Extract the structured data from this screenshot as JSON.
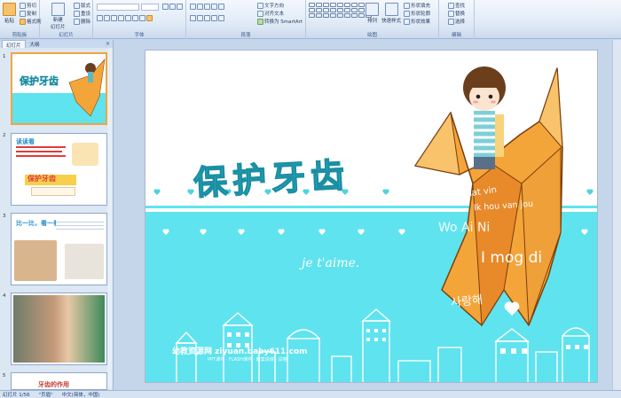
{
  "ribbon": {
    "clipboard": {
      "paste": "粘贴",
      "cut": "剪切",
      "copy": "复制",
      "format_painter": "格式刷",
      "label": "剪贴板"
    },
    "slides": {
      "new_slide": "新建",
      "new_slide2": "幻灯片",
      "layout": "版式",
      "reset": "重设",
      "delete": "删除",
      "label": "幻灯片"
    },
    "font": {
      "label": "字体"
    },
    "paragraph": {
      "text_direction": "文字方向",
      "align_text": "对齐文本",
      "smartart": "转换为 SmartArt",
      "label": "段落"
    },
    "drawing": {
      "arrange": "排列",
      "quick_styles": "快速样式",
      "shape_fill": "形状填充",
      "shape_outline": "形状轮廓",
      "shape_effects": "形状效果",
      "label": "绘图"
    },
    "editing": {
      "find": "查找",
      "replace": "替换",
      "select": "选择",
      "label": "编辑"
    }
  },
  "pane": {
    "tab_slides": "幻灯片",
    "tab_outline": "大纲",
    "close": "×",
    "thumbs": [
      {
        "num": "1",
        "title": "保护牙齿"
      },
      {
        "num": "2",
        "title": "读读看",
        "sub": "保护牙齿"
      },
      {
        "num": "3",
        "title": "比一比，看一看"
      },
      {
        "num": "4",
        "title": ""
      },
      {
        "num": "5",
        "title": "牙齿的作用"
      }
    ]
  },
  "slide": {
    "title": "保护牙齿",
    "phrases": [
      "amat vin",
      "Ik hou van jou",
      "je t'aime",
      "Wo Ai Ni",
      "I mog di",
      "사랑해"
    ],
    "script_text": "je t'aime.",
    "watermark": "幼教资源网 ziyuan.baby611.com",
    "watermark_sub": "PPT课件 · FLASH课件 · 教案说课 · 试卷"
  },
  "status": {
    "slide_index": "幻灯片 1/56",
    "theme": "\"页眉\"",
    "language": "中文(简体，中国)"
  },
  "colors": {
    "title_teal": "#3ecdd9",
    "cyan_band": "#5fe3ee",
    "crane_orange": "#f4a53a",
    "ribbon_bg": "#dde8f5"
  }
}
